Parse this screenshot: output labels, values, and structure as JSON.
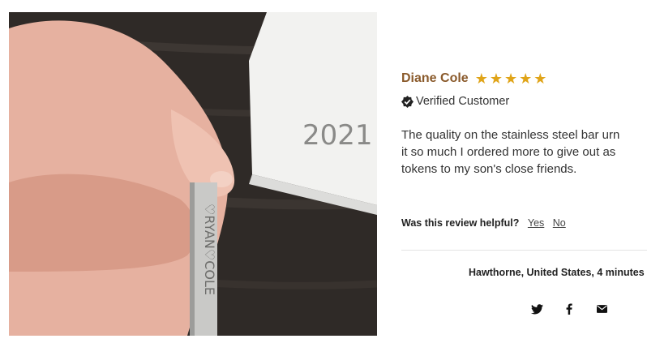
{
  "review": {
    "reviewer_name": "Diane Cole",
    "rating": 5,
    "verified_label": "Verified Customer",
    "body_lines": [
      "The quality on the stainless steel bar urn",
      "it so much I ordered more to give out as",
      "tokens to my son's close friends."
    ],
    "helpful_question": "Was this review helpful?",
    "helpful_yes": "Yes",
    "helpful_no": "No",
    "location_line": "Hawthorne, United States, 4 minutes"
  },
  "photo": {
    "card_text": "2021",
    "engraving": "♡RYAN♡COLE"
  },
  "share": [
    "twitter-icon",
    "facebook-icon",
    "email-icon"
  ],
  "colors": {
    "reviewer_name": "#8a5a2b",
    "star": "#e0a418",
    "divider": "#e3e3e3"
  }
}
